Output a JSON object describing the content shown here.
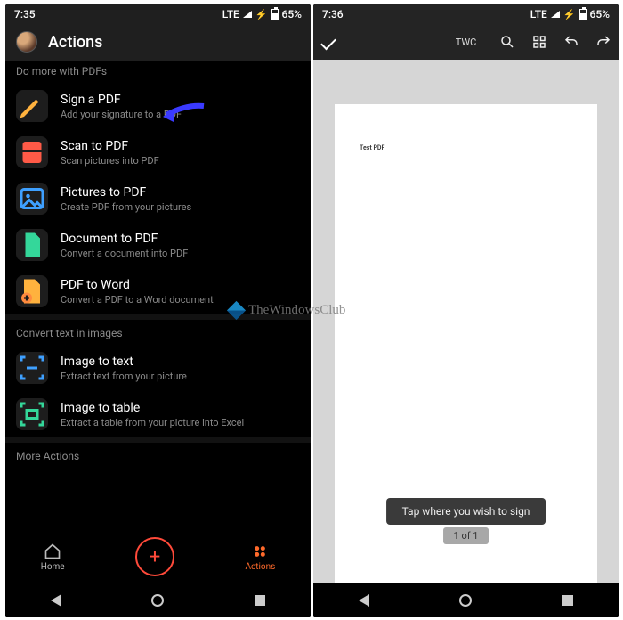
{
  "left": {
    "status": {
      "time": "7:35",
      "net": "LTE",
      "batt": "65%"
    },
    "header": {
      "title": "Actions"
    },
    "section1_label": "Do more with PDFs",
    "actions": [
      {
        "title": "Sign a PDF",
        "sub": "Add your signature to a PDF"
      },
      {
        "title": "Scan to PDF",
        "sub": "Scan pictures into PDF"
      },
      {
        "title": "Pictures to PDF",
        "sub": "Create PDF from your pictures"
      },
      {
        "title": "Document to PDF",
        "sub": "Convert a document into PDF"
      },
      {
        "title": "PDF to Word",
        "sub": "Convert a PDF to a Word document"
      }
    ],
    "section2_label": "Convert text in images",
    "actions2": [
      {
        "title": "Image to text",
        "sub": "Extract text from your picture"
      },
      {
        "title": "Image to table",
        "sub": "Extract a table from your picture into Excel"
      }
    ],
    "section3_label": "More Actions",
    "nav": {
      "home": "Home",
      "actions": "Actions"
    }
  },
  "right": {
    "status": {
      "time": "7:36",
      "net": "LTE",
      "batt": "65%"
    },
    "doc_title": "TWC",
    "page_text": "Test PDF",
    "toast": "Tap where you wish to sign",
    "page_indicator": "1 of 1"
  },
  "watermark": "TheWindowsClub"
}
